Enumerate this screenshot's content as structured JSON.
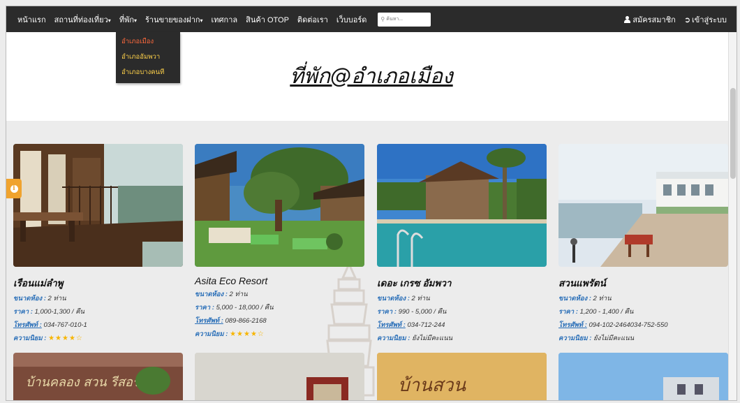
{
  "nav": {
    "items": [
      {
        "label": "หน้าแรก",
        "caret": false
      },
      {
        "label": "สถานที่ท่องเที่ยว",
        "caret": true
      },
      {
        "label": "ที่พัก",
        "caret": true
      },
      {
        "label": "ร้านขายของฝาก",
        "caret": true
      },
      {
        "label": "เทศกาล",
        "caret": false
      },
      {
        "label": "สินค้า OTOP",
        "caret": false
      },
      {
        "label": "ติดต่อเรา",
        "caret": false
      },
      {
        "label": "เว็บบอร์ด",
        "caret": false
      }
    ],
    "search_placeholder": "ค้นหา...",
    "register_label": "สมัครสมาชิก",
    "login_label": "เข้าสู่ระบบ"
  },
  "dropdown": {
    "items": [
      "อำเภอเมือง",
      "อำเภออัมพวา",
      "อำเภอบางคนที"
    ]
  },
  "page": {
    "title": "ที่พัก@อำเภอเมือง"
  },
  "labels": {
    "size": "ขนาดห้อง :",
    "price": "ราคา :",
    "phone": "โทรศัพท์ :",
    "popularity": "ความนิยม :"
  },
  "cards": [
    {
      "name": "เรือนแม่ลำพู",
      "size": "2 ท่าน",
      "price": "1,000-1,300 / คืน",
      "phone": "034-767-010-1",
      "rating": 4,
      "rating_text": "",
      "stars": "★★★★☆"
    },
    {
      "name": "Asita Eco Resort",
      "size": "2 ท่าน",
      "price": "5,000 - 18,000 / คืน",
      "phone": "089-866-2168",
      "rating": 4,
      "rating_text": "",
      "stars": "★★★★☆"
    },
    {
      "name": "เดอะ เกรซ อัมพวา",
      "size": "2 ท่าน",
      "price": "990 - 5,000 / คืน",
      "phone": "034-712-244",
      "rating": null,
      "rating_text": "ยังไม่มีคะแนน",
      "stars": ""
    },
    {
      "name": "สวนแพรัตน์",
      "size": "2 ท่าน",
      "price": "1,200 - 1,400 / คืน",
      "phone": "094-102-2464034-752-550",
      "rating": null,
      "rating_text": "ยังไม่มีคะแนน",
      "stars": ""
    }
  ],
  "bottom_cards": [
    {
      "sign_text": "บ้านคลอง สวน รีสอร์ต"
    },
    {
      "sign_text": ""
    },
    {
      "sign_text": "บ้านสวน"
    },
    {
      "sign_text": ""
    }
  ],
  "colors": {
    "navbar": "#2b2b2b",
    "dropdown_text": "#ffd24a",
    "dropdown_active": "#ff6a3d",
    "label_blue": "#2a6fb8",
    "star": "#f7b500",
    "info_tab": "#f0a32e"
  }
}
